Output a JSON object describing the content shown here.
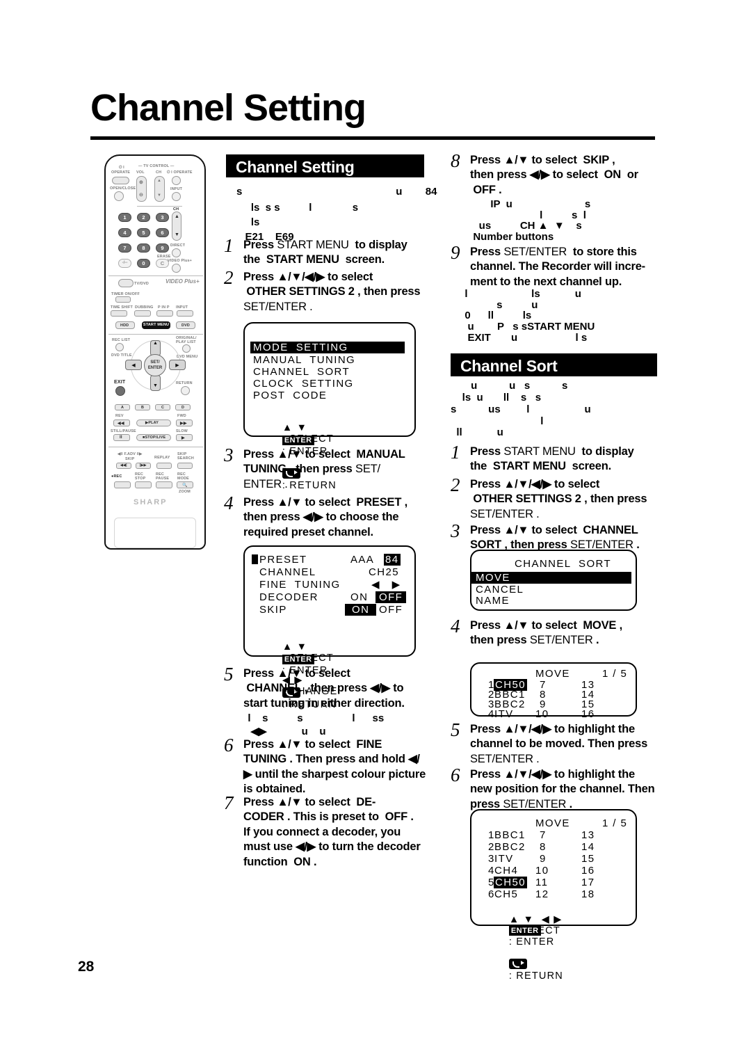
{
  "document": {
    "title": "Channel Setting",
    "page_number": "28"
  },
  "sections": {
    "channel_setting": {
      "heading": "Channel Setting",
      "intro_artifacts": [
        "s                                                     u        84",
        "     ls  s s          l              s",
        "     ls",
        "   E21    E69"
      ],
      "steps": [
        {
          "num": "1",
          "lines": [
            [
              {
                "t": "Press ",
                "b": true
              },
              {
                "t": "START MENU",
                "b": false
              },
              {
                "t": "  to display",
                "b": true
              }
            ],
            [
              {
                "t": "the  START MENU  screen.",
                "b": true
              }
            ]
          ]
        },
        {
          "num": "2",
          "lines": [
            [
              {
                "t": "Press ",
                "b": true
              },
              {
                "t": "▲/▼/◀/▶",
                "b": true
              },
              {
                "t": " to select",
                "b": true
              }
            ],
            [
              {
                "t": " OTHER SETTINGS 2 , then press",
                "b": true
              }
            ],
            [
              {
                "t": "SET/ENTER .",
                "b": false
              }
            ]
          ]
        },
        {
          "num": "3",
          "lines": [
            [
              {
                "t": "Press ",
                "b": true
              },
              {
                "t": "▲/▼",
                "b": true
              },
              {
                "t": " to select  MANUAL",
                "b": true
              }
            ],
            [
              {
                "t": "TUNING , then press ",
                "b": true
              },
              {
                "t": "SET/",
                "b": false
              }
            ],
            [
              {
                "t": "ENTER .",
                "b": false
              }
            ]
          ]
        },
        {
          "num": "4",
          "lines": [
            [
              {
                "t": "Press ",
                "b": true
              },
              {
                "t": "▲/▼",
                "b": true
              },
              {
                "t": " to select  PRESET ,",
                "b": true
              }
            ],
            [
              {
                "t": "then press ",
                "b": true
              },
              {
                "t": "◀/▶",
                "b": true
              },
              {
                "t": " to choose the",
                "b": true
              }
            ],
            [
              {
                "t": "required preset channel.",
                "b": true
              }
            ]
          ]
        },
        {
          "num": "5",
          "lines": [
            [
              {
                "t": "Press ",
                "b": true
              },
              {
                "t": "▲/▼",
                "b": true
              },
              {
                "t": " to select",
                "b": true
              }
            ],
            [
              {
                "t": " CHANNEL , then press ",
                "b": true
              },
              {
                "t": "◀/▶",
                "b": true
              },
              {
                "t": " to",
                "b": true
              }
            ],
            [
              {
                "t": "start tuning in either direction.",
                "b": true
              }
            ]
          ]
        },
        {
          "num": "6",
          "lines": [
            [
              {
                "t": "Press ",
                "b": true
              },
              {
                "t": "▲/▼",
                "b": true
              },
              {
                "t": " to select  FINE",
                "b": true
              }
            ],
            [
              {
                "t": "TUNING . Then press and hold ",
                "b": true
              },
              {
                "t": "◀/",
                "b": true
              }
            ],
            [
              {
                "t": "▶",
                "b": true
              },
              {
                "t": " until the sharpest colour picture",
                "b": true
              }
            ],
            [
              {
                "t": "is obtained.",
                "b": true
              }
            ]
          ]
        },
        {
          "num": "7",
          "lines": [
            [
              {
                "t": "Press ",
                "b": true
              },
              {
                "t": "▲/▼",
                "b": true
              },
              {
                "t": " to select  DE-",
                "b": true
              }
            ],
            [
              {
                "t": "CODER . This is preset to  OFF .",
                "b": true
              }
            ],
            [
              {
                "t": "If you connect a decoder, you",
                "b": true
              }
            ],
            [
              {
                "t": "must use ",
                "b": true
              },
              {
                "t": "◀/▶",
                "b": true
              },
              {
                "t": " to turn the decoder",
                "b": true
              }
            ],
            [
              {
                "t": "function  ON .",
                "b": true
              }
            ]
          ]
        },
        {
          "num": "8",
          "lines": [
            [
              {
                "t": "Press ",
                "b": true
              },
              {
                "t": "▲/▼",
                "b": true
              },
              {
                "t": " to select  SKIP ,",
                "b": true
              }
            ],
            [
              {
                "t": "then press ",
                "b": true
              },
              {
                "t": "◀/▶",
                "b": true
              },
              {
                "t": " to select  ON  or",
                "b": true
              }
            ],
            [
              {
                "t": " OFF .",
                "b": true
              }
            ]
          ]
        },
        {
          "num": "9",
          "lines": [
            [
              {
                "t": "Press ",
                "b": true
              },
              {
                "t": "SET/ENTER",
                "b": false
              },
              {
                "t": "  to store this",
                "b": true
              }
            ],
            [
              {
                "t": "channel. The Recorder will incre-",
                "b": true
              }
            ],
            [
              {
                "t": "ment to the next channel up.",
                "b": true
              }
            ]
          ]
        }
      ],
      "step5_artifacts": [
        "  l    s          s                 l      ss",
        "   ◀▶            u    u"
      ],
      "step8_artifacts": [
        "        IP  u                         s",
        "                         l          s  l",
        "    us          CH ▲  ▼    s",
        "  Number buttons"
      ],
      "step9_artifacts": [
        "  l                      ls            u",
        "             s          u",
        "  0      ll          ls",
        "   u        P   s sSTART MENU",
        "   EXIT       u                    l s"
      ]
    },
    "channel_sort": {
      "heading": "Channel Sort",
      "intro_artifacts": [
        "       u           u   s           s",
        "    ls  u       ll    s   s",
        "s           us         l                   u",
        "                               l",
        "  ll            u"
      ],
      "steps": [
        {
          "num": "1",
          "lines": [
            [
              {
                "t": "Press ",
                "b": true
              },
              {
                "t": "START MENU",
                "b": false
              },
              {
                "t": "  to display",
                "b": true
              }
            ],
            [
              {
                "t": "the  START MENU  screen.",
                "b": true
              }
            ]
          ]
        },
        {
          "num": "2",
          "lines": [
            [
              {
                "t": "Press ",
                "b": true
              },
              {
                "t": "▲/▼/◀/▶",
                "b": true
              },
              {
                "t": " to select",
                "b": true
              }
            ],
            [
              {
                "t": " OTHER SETTINGS 2 , then press",
                "b": true
              }
            ],
            [
              {
                "t": "SET/ENTER .",
                "b": false
              }
            ]
          ]
        },
        {
          "num": "3",
          "lines": [
            [
              {
                "t": "Press ",
                "b": true
              },
              {
                "t": "▲/▼",
                "b": true
              },
              {
                "t": " to select  CHANNEL",
                "b": true
              }
            ],
            [
              {
                "t": "SORT , then press ",
                "b": true
              },
              {
                "t": "SET/ENTER",
                "b": false
              },
              {
                "t": " .",
                "b": true
              }
            ]
          ]
        },
        {
          "num": "4",
          "lines": [
            [
              {
                "t": "Press ",
                "b": true
              },
              {
                "t": "▲/▼",
                "b": true
              },
              {
                "t": " to select  MOVE ,",
                "b": true
              }
            ],
            [
              {
                "t": "then press ",
                "b": true
              },
              {
                "t": "SET/ENTER",
                "b": false
              },
              {
                "t": " .",
                "b": true
              }
            ]
          ]
        },
        {
          "num": "5",
          "lines": [
            [
              {
                "t": "Press ",
                "b": true
              },
              {
                "t": "▲/▼/◀/▶",
                "b": true
              },
              {
                "t": " to highlight the",
                "b": true
              }
            ],
            [
              {
                "t": "channel to be moved. Then press",
                "b": true
              }
            ],
            [
              {
                "t": "SET/ENTER .",
                "b": false
              }
            ]
          ]
        },
        {
          "num": "6",
          "lines": [
            [
              {
                "t": "Press ",
                "b": true
              },
              {
                "t": "▲/▼/◀/▶",
                "b": true
              },
              {
                "t": " to highlight the",
                "b": true
              }
            ],
            [
              {
                "t": "new position for the channel. Then",
                "b": true
              }
            ],
            [
              {
                "t": "press ",
                "b": true
              },
              {
                "t": "SET/ENTER",
                "b": false
              },
              {
                "t": " .",
                "b": true
              }
            ]
          ]
        }
      ]
    }
  },
  "osd": {
    "other_settings_menu": {
      "items": [
        "MODE  SETTING",
        "MANUAL  TUNING",
        "CHANNEL  SORT",
        "CLOCK  SETTING",
        "POST  CODE"
      ],
      "highlighted_index": 0,
      "footer": {
        "select_keys": "▲ ▼",
        "select_label": ": SELECT",
        "enter_key": "ENTER",
        "enter_label": ": ENTER",
        "return_label": ": RETURN"
      }
    },
    "manual_tuning": {
      "rows": [
        {
          "label": "PRESET",
          "mid": "AAA",
          "value": "84",
          "value_highlight": true,
          "cursor": true
        },
        {
          "label": "CHANNEL",
          "mid": "",
          "value": "CH25",
          "value_highlight": false,
          "cursor": false
        },
        {
          "label": "FINE  TUNING",
          "mid": "",
          "value": "◀   ▶",
          "value_highlight": false,
          "cursor": false
        },
        {
          "label": "DECODER",
          "mid": "ON",
          "value": "OFF",
          "value_highlight": true,
          "cursor": false
        },
        {
          "label": "SKIP",
          "mid": "ON",
          "value": "OFF",
          "value_highlight": false,
          "mid_highlight": true,
          "cursor": false
        }
      ],
      "footer": {
        "select_keys": "▲ ▼",
        "select_label": ": SELECT",
        "change_keys": "◀ ▶",
        "change_label": ": CHANGE",
        "enter_key": "ENTER",
        "enter_label": ": ENTER",
        "return_label": ": RETURN"
      }
    },
    "channel_sort_menu": {
      "title": "CHANNEL  SORT",
      "items": [
        "MOVE",
        "CANCEL",
        "NAME"
      ],
      "highlighted_index": 0
    },
    "move_before": {
      "title": "MOVE",
      "page": "1 / 5",
      "col1": [
        {
          "num": "1",
          "name": "CH50",
          "highlight": true
        },
        {
          "num": "2",
          "name": "BBC1",
          "highlight": false
        },
        {
          "num": "3",
          "name": "BBC2",
          "highlight": false
        },
        {
          "num": "4",
          "name": "ITV",
          "highlight": false
        }
      ],
      "col2": [
        "7",
        "8",
        "9",
        "10"
      ],
      "col3": [
        "13",
        "14",
        "15",
        "16"
      ]
    },
    "move_after": {
      "title": "MOVE",
      "page": "1 / 5",
      "col1": [
        {
          "num": "1",
          "name": "BBC1",
          "highlight": false
        },
        {
          "num": "2",
          "name": "BBC2",
          "highlight": false
        },
        {
          "num": "3",
          "name": "ITV",
          "highlight": false
        },
        {
          "num": "4",
          "name": "CH4",
          "highlight": false
        },
        {
          "num": "5",
          "name": "CH50",
          "highlight": true
        },
        {
          "num": "6",
          "name": "CH5",
          "highlight": false
        }
      ],
      "col2": [
        "7",
        "8",
        "9",
        "10",
        "11",
        "12"
      ],
      "col3": [
        "13",
        "14",
        "15",
        "16",
        "17",
        "18"
      ],
      "footer": {
        "select_keys": "▲ ▼  ◀ ▶",
        "select_label": ": SELECT",
        "enter_key": "ENTER",
        "enter_label": ": ENTER",
        "return_label": ": RETURN"
      }
    }
  },
  "remote": {
    "brand": "SHARP",
    "labels": {
      "tv_control": "— TV CONTROL —",
      "operate_left": "OPERATE",
      "operate_power": "⏻ I",
      "vol": "VOL",
      "ch": "CH",
      "operate_right": "⏻ I OPERATE",
      "open_close": "OPEN/CLOSE",
      "input_top": "INPUT",
      "ch_side": "CH",
      "direct": "DIRECT",
      "erase": "ERASE",
      "video_plus": "VIDEO Plus+",
      "tv_dvd": "TV/DVD",
      "timer_on_off": "TIMER ON/OFF",
      "time_shift": "TIME SHIFT",
      "dubbing": "DUBBING",
      "pinp": "P IN P",
      "input_mid": "INPUT",
      "hdd": "HDD",
      "start_menu": "START MENU",
      "dvd": "DVD",
      "rec_list": "REC LIST",
      "dvd_title": "DVD TITLE",
      "original_play_list": "ORIGINAL/\nPLAY LIST",
      "dvd_menu": "DVD MENU",
      "set_enter": "SET/\nENTER",
      "exit": "EXIT",
      "return": "RETURN",
      "color_a": "A",
      "color_b": "B",
      "color_c": "C",
      "color_d": "D",
      "rev": "REV",
      "fwd": "FWD",
      "play": "▶PLAY",
      "still_pause": "STILL/PAUSE",
      "slow": "SLOW",
      "stop_live": "■STOP/LIVE",
      "f_adv": "◀ll F.ADV ll▶",
      "skip_left": "SKIP",
      "replay": "REPLAY",
      "skip_search": "SKIP\nSEARCH",
      "rec": "●REC",
      "rec_stop": "REC\nSTOP",
      "rec_pause": "REC\nPAUSE",
      "rec_mode": "REC\nMODE",
      "zoom": "ZOOM"
    },
    "number_keys": [
      "1",
      "2",
      "3",
      "4",
      "5",
      "6",
      "7",
      "8",
      "9",
      "-/--",
      "0",
      "C"
    ]
  }
}
